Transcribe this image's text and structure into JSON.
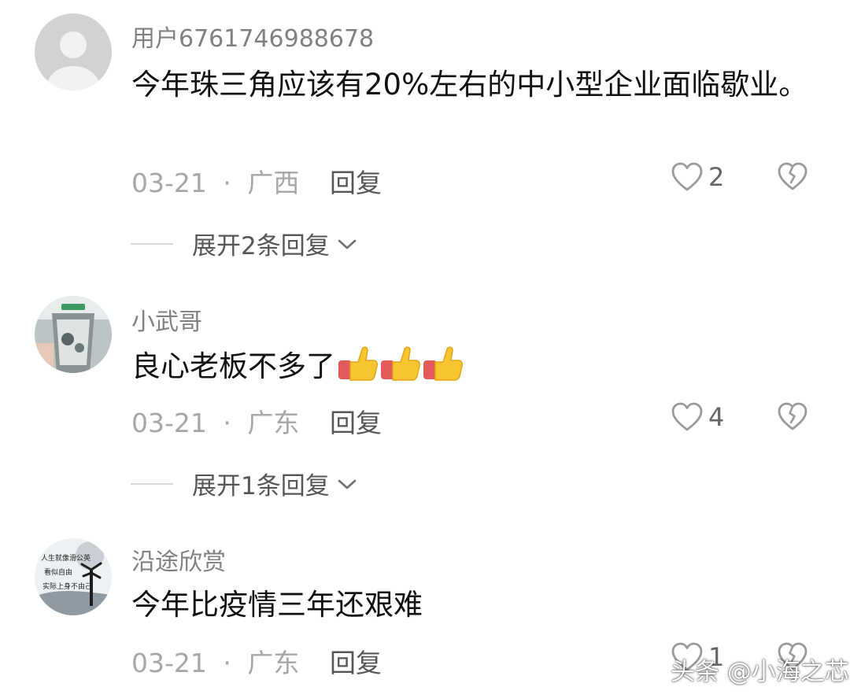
{
  "comments": [
    {
      "username": "用户6761746988678",
      "avatar_icon": "default-user-avatar",
      "text": "今年珠三角应该有20%左右的中小型企业面临歇业。",
      "date": "03-21",
      "separator": "·",
      "location": "广西",
      "reply_label": "回复",
      "likes": "2",
      "expand_label": "展开2条回复"
    },
    {
      "username": "小武哥",
      "avatar_icon": "photo-avatar",
      "text": "良心老板不多了",
      "emoji": "thumbs-up-icon x3",
      "date": "03-21",
      "separator": "·",
      "location": "广东",
      "reply_label": "回复",
      "likes": "4",
      "expand_label": "展开1条回复"
    },
    {
      "username": "沿途欣赏",
      "avatar_icon": "photo-avatar",
      "avatar_text": [
        "人生就像滑公英",
        "看似自由",
        "实际上身不由己"
      ],
      "text": "今年比疫情三年还艰难",
      "date": "03-21",
      "separator": "·",
      "location": "广东",
      "reply_label": "回复",
      "likes": "1"
    }
  ],
  "watermark": "头条 @小海之芯",
  "colors": {
    "username": "#808080",
    "body": "#111111",
    "meta": "#a7a7a7",
    "reply": "#565656",
    "icon": "#9a9a9a"
  }
}
